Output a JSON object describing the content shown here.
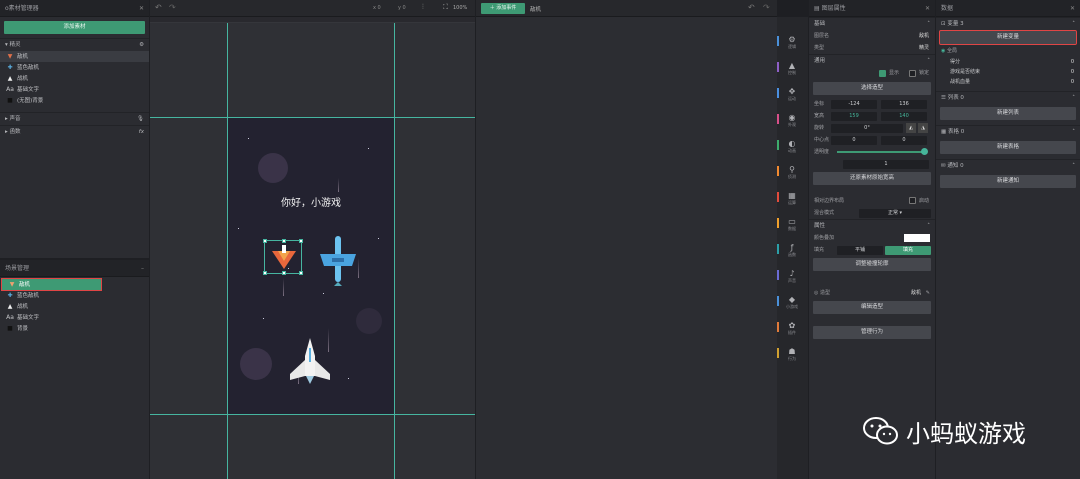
{
  "left": {
    "title": "o素材管理器",
    "add_btn": "添加素材",
    "group_sprite": "精灵",
    "sprites": [
      "敌机",
      "蓝色敌机",
      "战机",
      "基础文字",
      "(无图)背景"
    ],
    "group_sound": "声音",
    "group_fn": "函数"
  },
  "scene": {
    "title": "场景管理",
    "items": [
      "敌机",
      "蓝色敌机",
      "战机",
      "基础文字",
      "背景"
    ]
  },
  "toolbar": {
    "coord_x": "x 0",
    "coord_y": "y 0",
    "zoom": "100%"
  },
  "canvas": {
    "hello": "你好，小游戏"
  },
  "events": {
    "add": "添加事件",
    "tab": "敌机"
  },
  "props": {
    "title": "图层属性",
    "sec_basic": "基础",
    "layer_name_label": "图层名",
    "layer_name": "敌机",
    "type_label": "类型",
    "type": "精灵",
    "sec_general": "通用",
    "show": "显示",
    "lock": "锁定",
    "choose_shape": "选择造型",
    "pos_label": "坐标",
    "x": "-124",
    "y": "136",
    "size_label": "宽高",
    "w": "159",
    "h": "140",
    "rot_label": "旋转",
    "rot": "0°",
    "center_label": "中心点",
    "cx": "0",
    "cy": "0",
    "opacity_label": "透明度",
    "opacity": "1",
    "restore": "还原素材原始宽高",
    "physics": "相对边界布局",
    "physics_opt": "启动",
    "blend_label": "混合模式",
    "blend": "正常",
    "sec_attr": "属性",
    "color_label": "颜色叠加",
    "fill_label": "填充",
    "fill_a": "平铺",
    "fill_b": "填充",
    "adjust": "调整碰撞轮廓",
    "shape_label": "造型",
    "shape_val": "敌机",
    "edit_shape": "编辑造型",
    "manage_behavior": "管理行为"
  },
  "tabs": [
    "逻辑",
    "控制",
    "运动",
    "外观",
    "动画",
    "侦测",
    "运算",
    "数据",
    "函数",
    "声音",
    "小游戏",
    "插件",
    "行为"
  ],
  "tab_colors": [
    "#4a90d9",
    "#8e5fc7",
    "#4a8fe0",
    "#d84f8a",
    "#3dac6c",
    "#f28a30",
    "#e24b3c",
    "#f0a02c",
    "#2b9fa8",
    "#6b6bd6",
    "#4a90d9",
    "#e07a3a",
    "#d0a030"
  ],
  "data": {
    "title": "数据",
    "vars": "变量 3",
    "new_var": "新建变量",
    "global": "全局",
    "var_list": [
      {
        "name": "得分",
        "val": "0"
      },
      {
        "name": "游戏是否结束",
        "val": "0"
      },
      {
        "name": "战机血量",
        "val": "0"
      }
    ],
    "lists": "列表 0",
    "new_list": "新建列表",
    "tables": "表格 0",
    "new_table": "新建表格",
    "notices": "通知 0",
    "new_notice": "新建通知"
  },
  "watermark": "小蚂蚁游戏"
}
